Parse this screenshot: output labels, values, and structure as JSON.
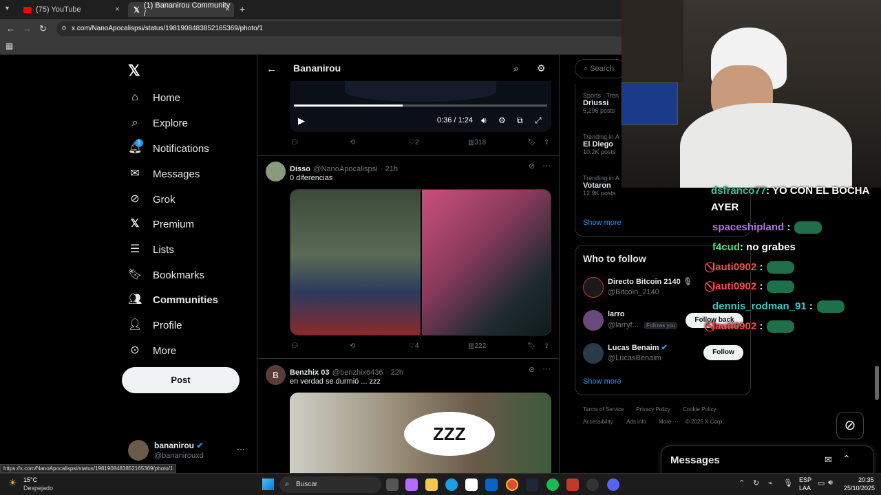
{
  "browser": {
    "tabs": [
      {
        "title": "(75) YouTube"
      },
      {
        "title": "(1) Bananirou Community /"
      }
    ],
    "new_tab": "+",
    "url": "x.com/NanoApocalispsi/status/1981908483852165369/photo/1",
    "status_url": "https://x.com/NanoApocalispsi/status/1981908483852165369/photo/1"
  },
  "nav": {
    "items": [
      {
        "label": "Home",
        "icon": "home-icon"
      },
      {
        "label": "Explore",
        "icon": "search-icon"
      },
      {
        "label": "Notifications",
        "icon": "bell-icon",
        "badge": "1"
      },
      {
        "label": "Messages",
        "icon": "mail-icon"
      },
      {
        "label": "Grok",
        "icon": "grok-icon"
      },
      {
        "label": "Premium",
        "icon": "x-icon"
      },
      {
        "label": "Lists",
        "icon": "list-icon"
      },
      {
        "label": "Bookmarks",
        "icon": "bookmark-icon"
      },
      {
        "label": "Communities",
        "icon": "people-icon"
      },
      {
        "label": "Profile",
        "icon": "person-icon"
      },
      {
        "label": "More",
        "icon": "more-circle-icon"
      }
    ],
    "post_label": "Post",
    "account_name": "bananirou",
    "account_handle": "@bananirouxd"
  },
  "header": {
    "title": "Bananirou"
  },
  "video": {
    "time": "0:36 / 1:24",
    "progress": 0.43
  },
  "tweet0_actions": {
    "likes": "2",
    "views": "318"
  },
  "tweet1": {
    "name": "Disso",
    "handle": "@NanoApocalispsi",
    "time": "· 21h",
    "text": "0 diferencias",
    "likes": "4",
    "views": "222"
  },
  "tweet2": {
    "name": "Benzhix 03",
    "handle": "@benzhix6436",
    "time": "· 22h",
    "text": "en verdad se durmió ... zzz",
    "avatar_letter": "B",
    "image_text": "ZZZ"
  },
  "sidebar": {
    "search_placeholder": "Search",
    "trends": [
      {
        "category": "Sports · Tren",
        "name": "Driussi",
        "posts": "5,296 posts"
      },
      {
        "category": "Trending in A",
        "name": "El Diego",
        "posts": "10.2K posts"
      },
      {
        "category": "Trending in A",
        "name": "Votaron",
        "posts": "12.9K posts"
      }
    ],
    "show_more": "Show more",
    "wtf_title": "Who to follow",
    "wtf": [
      {
        "name": "Directo Bitcoin 2140",
        "handle": "@Bitcoin_2140"
      },
      {
        "name": "larro",
        "handle": "@larryf...",
        "badge": "Follows you",
        "button": "Follow back"
      },
      {
        "name": "Lucas Benaim",
        "handle": "@LucasBenaim",
        "button": "Follow"
      }
    ],
    "show_more2": "Show more",
    "footer": [
      "Terms of Service",
      "Privacy Policy",
      "Cookie Policy",
      "Accessibility",
      "Ads info",
      "More ···",
      "© 2025 X Corp."
    ],
    "messages_title": "Messages"
  },
  "chat": [
    {
      "user": "dsfranco77",
      "text": ": YO CON EL BOCHA",
      "color": "#1fd19b"
    },
    {
      "user": "",
      "text": "AYER",
      "color": "#ffffff"
    },
    {
      "user": "spaceshipland",
      "text": ":",
      "color": "#b06cff"
    },
    {
      "user": "f4cud",
      "text": ": no grabes",
      "color": "#44e07a"
    },
    {
      "user": "lauti0902",
      "text": ":",
      "color": "#ff4a4a"
    },
    {
      "user": "lauti0902",
      "text": ":",
      "color": "#ff4a4a"
    },
    {
      "user": "dennis_rodman_91",
      "text": ":",
      "color": "#40c8c8"
    },
    {
      "user": "lauti0902",
      "text": ":",
      "color": "#ff4a4a"
    }
  ],
  "taskbar": {
    "weather_temp": "15°C",
    "weather_desc": "Despejado",
    "search": "Buscar",
    "lang": "ESP",
    "lang2": "LAA",
    "time": "20:35",
    "date": "25/10/2025"
  }
}
